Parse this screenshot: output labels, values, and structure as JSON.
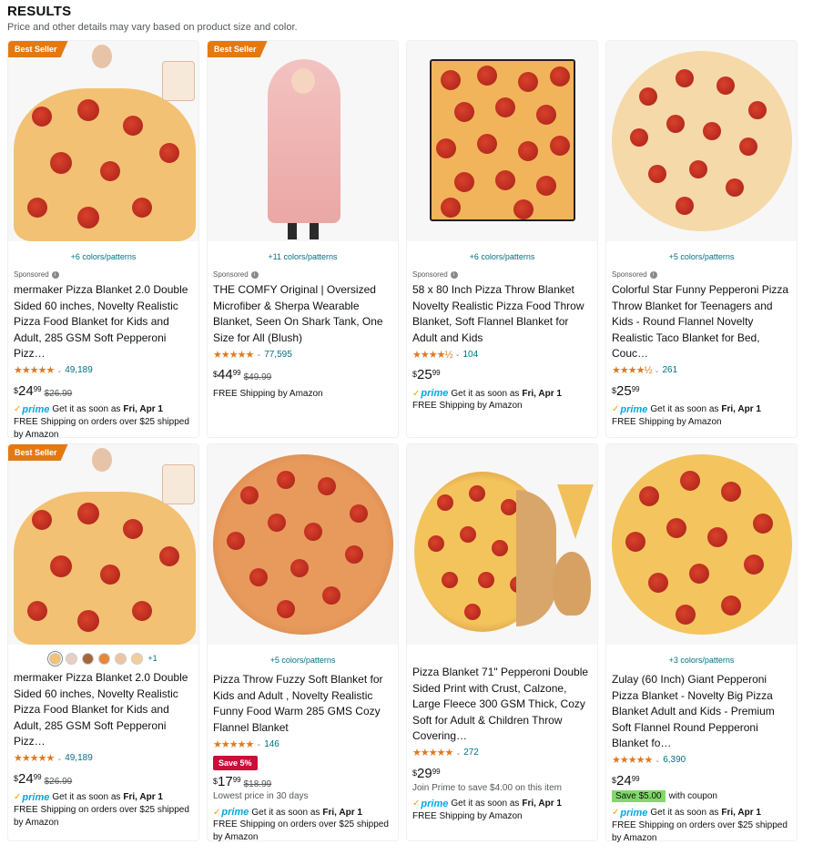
{
  "header": {
    "title": "RESULTS",
    "subtitle": "Price and other details may vary based on product size and color."
  },
  "colors": {
    "badge": "#e47911",
    "link": "#007185",
    "star": "#de7921",
    "prime": "#00a8e1",
    "deal": "#cc0c39",
    "coupon": "#7fda69"
  },
  "products": [
    {
      "badge": "Best Seller",
      "variants": "+6 colors/patterns",
      "sponsored": "Sponsored",
      "title": "mermaker Pizza Blanket 2.0 Double Sided 60 inches, Novelty Realistic Pizza Food Blanket for Kids and Adult, 285 GSM Soft Pepperoni Pizz…",
      "stars": "★★★★★",
      "rating_count": "49,189",
      "price_currency": "$",
      "price_whole": "24",
      "price_frac": "99",
      "list_price": "$26.99",
      "prime": "prime",
      "delivery": "Get it as soon as",
      "delivery_date": "Fri, Apr 1",
      "shipping": "FREE Shipping on orders over $25 shipped by Amazon"
    },
    {
      "badge": "Best Seller",
      "variants": "+11 colors/patterns",
      "sponsored": "Sponsored",
      "title": "THE COMFY Original | Oversized Microfiber & Sherpa Wearable Blanket, Seen On Shark Tank, One Size for All (Blush)",
      "stars": "★★★★★",
      "rating_count": "77,595",
      "price_currency": "$",
      "price_whole": "44",
      "price_frac": "99",
      "list_price": "$49.99",
      "shipping": "FREE Shipping by Amazon"
    },
    {
      "variants": "+6 colors/patterns",
      "sponsored": "Sponsored",
      "title": "58 x 80 Inch Pizza Throw Blanket Novelty Realistic Pizza Food Throw Blanket, Soft Flannel Blanket for Adult and Kids",
      "stars": "★★★★½",
      "rating_count": "104",
      "price_currency": "$",
      "price_whole": "25",
      "price_frac": "99",
      "prime": "prime",
      "delivery": "Get it as soon as",
      "delivery_date": "Fri, Apr 1",
      "shipping": "FREE Shipping by Amazon"
    },
    {
      "variants": "+5 colors/patterns",
      "sponsored": "Sponsored",
      "title": "Colorful Star Funny Pepperoni Pizza Throw Blanket for Teenagers and Kids - Round Flannel Novelty Realistic Taco Blanket for Bed, Couc…",
      "stars": "★★★★½",
      "rating_count": "261",
      "price_currency": "$",
      "price_whole": "25",
      "price_frac": "99",
      "prime": "prime",
      "delivery": "Get it as soon as",
      "delivery_date": "Fri, Apr 1",
      "shipping": "FREE Shipping by Amazon"
    },
    {
      "badge": "Best Seller",
      "swatch_more": "+1",
      "title": "mermaker Pizza Blanket 2.0 Double Sided 60 inches, Novelty Realistic Pizza Food Blanket for Kids and Adult, 285 GSM Soft Pepperoni Pizz…",
      "stars": "★★★★★",
      "rating_count": "49,189",
      "price_currency": "$",
      "price_whole": "24",
      "price_frac": "99",
      "list_price": "$26.99",
      "prime": "prime",
      "delivery": "Get it as soon as",
      "delivery_date": "Fri, Apr 1",
      "shipping": "FREE Shipping on orders over $25 shipped by Amazon"
    },
    {
      "variants": "+5 colors/patterns",
      "title": "Pizza Throw Fuzzy Soft Blanket for Kids and Adult , Novelty Realistic Funny Food Warm 285 GMS Cozy Flannel Blanket",
      "stars": "★★★★★",
      "rating_count": "146",
      "deal": "Save 5%",
      "price_currency": "$",
      "price_whole": "17",
      "price_frac": "99",
      "list_price": "$18.99",
      "lowest": "Lowest price in 30 days",
      "prime": "prime",
      "delivery": "Get it as soon as",
      "delivery_date": "Fri, Apr 1",
      "shipping": "FREE Shipping on orders over $25 shipped by Amazon"
    },
    {
      "title": "Pizza Blanket 71\" Pepperoni Double Sided Print with Crust, Calzone, Large Fleece 300 GSM Thick, Cozy Soft for Adult & Children Throw Covering…",
      "stars": "★★★★★",
      "rating_count": "272",
      "price_currency": "$",
      "price_whole": "29",
      "price_frac": "99",
      "join_prime": "Join Prime to save $4.00 on this item",
      "prime": "prime",
      "delivery": "Get it as soon as",
      "delivery_date": "Fri, Apr 1",
      "shipping": "FREE Shipping by Amazon"
    },
    {
      "variants": "+3 colors/patterns",
      "title": "Zulay (60 Inch) Giant Pepperoni Pizza Blanket - Novelty Big Pizza Blanket Adult and Kids - Premium Soft Flannel Round Pepperoni Blanket fo…",
      "stars": "★★★★★",
      "rating_count": "6,390",
      "price_currency": "$",
      "price_whole": "24",
      "price_frac": "99",
      "coupon": "Save $5.00",
      "coupon_suffix": "with coupon",
      "prime": "prime",
      "delivery": "Get it as soon as",
      "delivery_date": "Fri, Apr 1",
      "shipping": "FREE Shipping on orders over $25 shipped by Amazon"
    }
  ]
}
